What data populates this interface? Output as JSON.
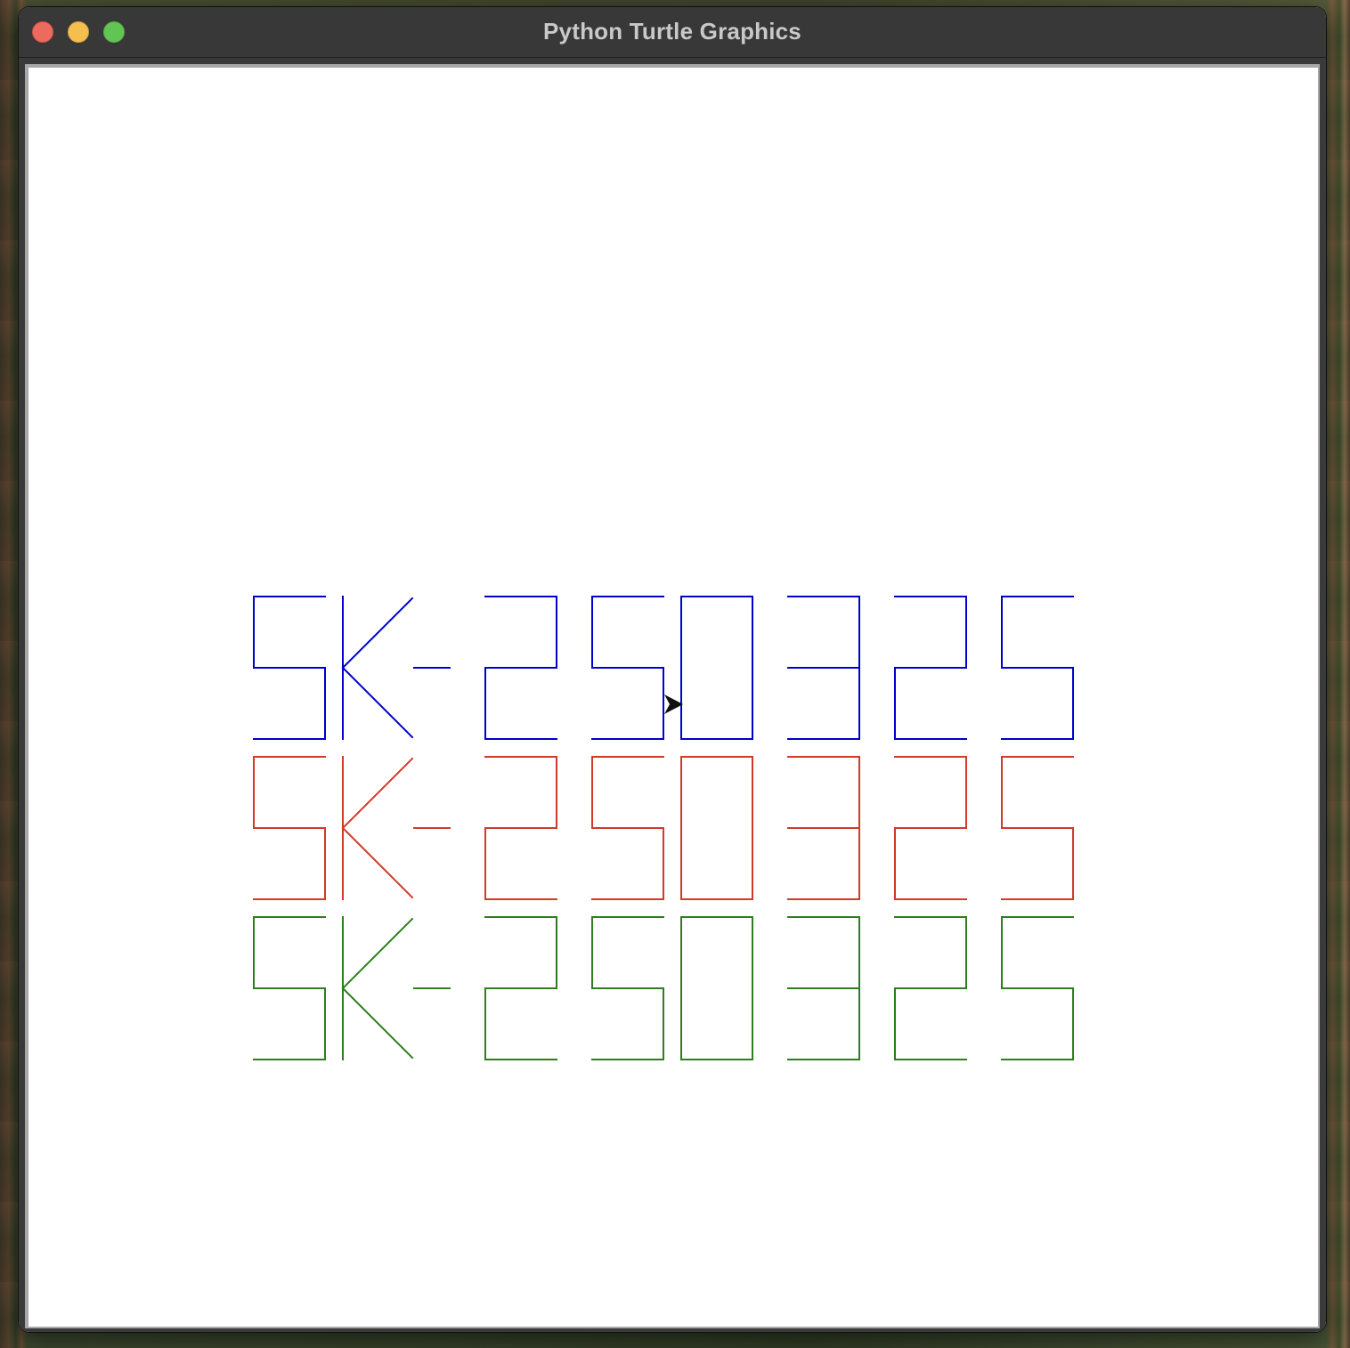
{
  "window": {
    "title": "Python Turtle Graphics"
  },
  "canvas": {
    "background": "#ffffff",
    "rows": [
      {
        "text": "SK-250325",
        "color": "#0000cc"
      },
      {
        "text": "SK-250325",
        "color": "#d03a2a"
      },
      {
        "text": "SK-250325",
        "color": "#2e7d1e"
      }
    ],
    "turtle": {
      "shape": "arrow-cursor-icon",
      "color": "#111111",
      "heading": "east"
    }
  }
}
